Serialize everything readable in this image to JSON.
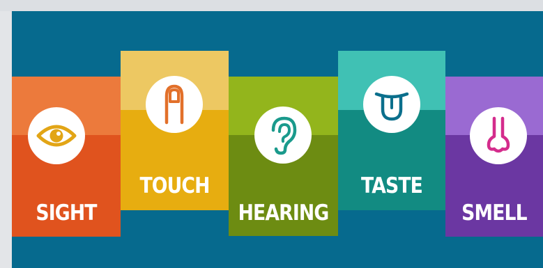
{
  "senses": [
    {
      "label": "SIGHT",
      "icon": "eye-icon",
      "top_color": "#ec7a3c",
      "bottom_color": "#e0531e",
      "icon_color": "#e2a516"
    },
    {
      "label": "TOUCH",
      "icon": "finger-icon",
      "top_color": "#edc862",
      "bottom_color": "#e7ad10",
      "icon_color": "#e2702a"
    },
    {
      "label": "HEARING",
      "icon": "ear-icon",
      "top_color": "#93b51c",
      "bottom_color": "#6d8c12",
      "icon_color": "#1a9a8c"
    },
    {
      "label": "TASTE",
      "icon": "tongue-icon",
      "top_color": "#40c1b4",
      "bottom_color": "#128b82",
      "icon_color": "#0b6f8c"
    },
    {
      "label": "SMELL",
      "icon": "nose-icon",
      "top_color": "#9a6ad2",
      "bottom_color": "#6b37a2",
      "icon_color": "#d42c8c"
    }
  ]
}
